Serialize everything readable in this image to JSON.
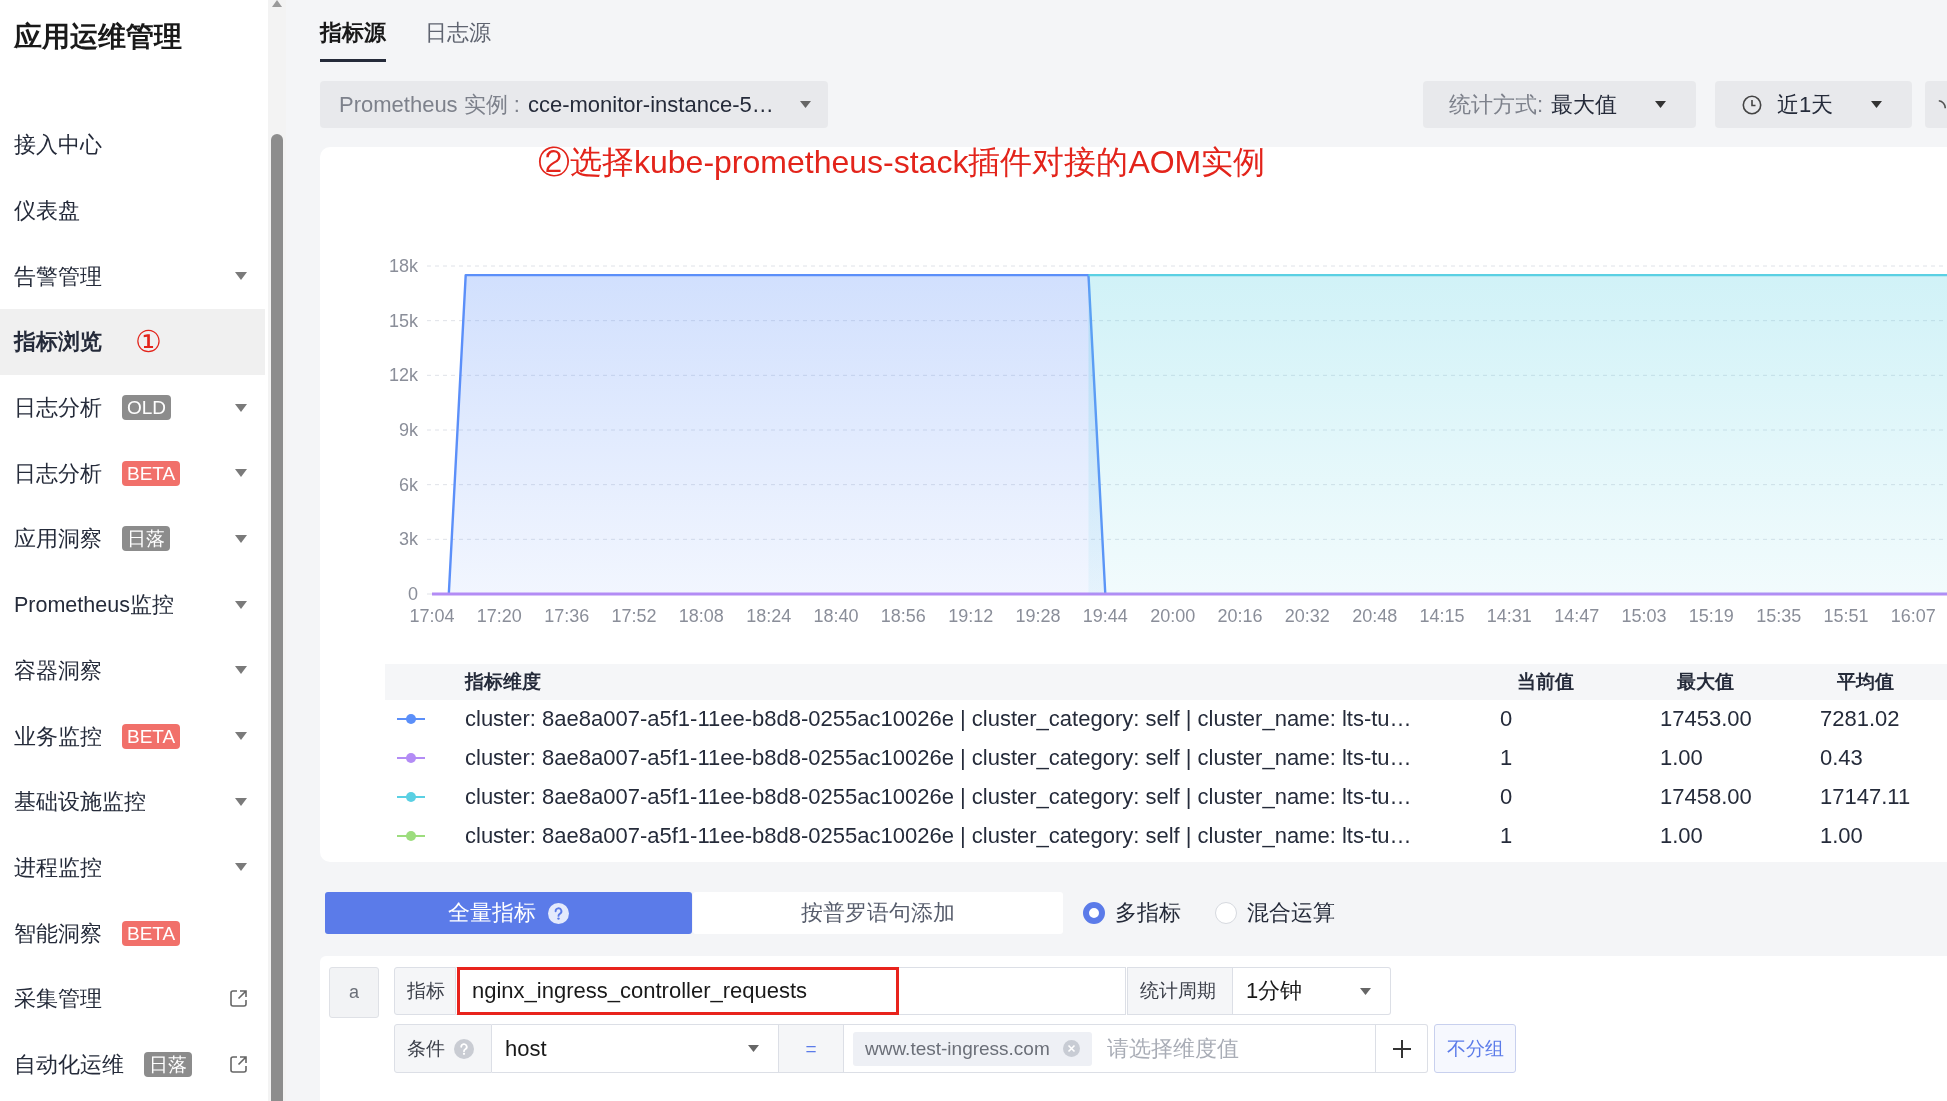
{
  "sidebar": {
    "title": "应用运维管理",
    "items": [
      {
        "label": "接入中心",
        "selected": false,
        "kind": "page"
      },
      {
        "label": "仪表盘",
        "selected": false,
        "kind": "page"
      },
      {
        "label": "告警管理",
        "selected": false,
        "kind": "menu"
      },
      {
        "label": "指标浏览",
        "selected": true,
        "kind": "page",
        "annotation": "①"
      },
      {
        "label": "日志分析",
        "selected": false,
        "kind": "menu",
        "badge": {
          "text": "OLD",
          "color": "#8c8c8c"
        }
      },
      {
        "label": "日志分析",
        "selected": false,
        "kind": "menu",
        "badge": {
          "text": "BETA",
          "color": "#f1706a"
        }
      },
      {
        "label": "应用洞察",
        "selected": false,
        "kind": "menu",
        "badge": {
          "text": "日落",
          "color": "#8c8c8c"
        }
      },
      {
        "label": "Prometheus监控",
        "selected": false,
        "kind": "menu"
      },
      {
        "label": "容器洞察",
        "selected": false,
        "kind": "menu"
      },
      {
        "label": "业务监控",
        "selected": false,
        "kind": "menu",
        "badge": {
          "text": "BETA",
          "color": "#f1706a"
        }
      },
      {
        "label": "基础设施监控",
        "selected": false,
        "kind": "menu"
      },
      {
        "label": "进程监控",
        "selected": false,
        "kind": "menu"
      },
      {
        "label": "智能洞察",
        "selected": false,
        "kind": "page",
        "badge": {
          "text": "BETA",
          "color": "#f1706a"
        }
      },
      {
        "label": "采集管理",
        "selected": false,
        "kind": "external"
      },
      {
        "label": "自动化运维",
        "selected": false,
        "kind": "external",
        "badge": {
          "text": "日落",
          "color": "#8c8c8c"
        }
      }
    ]
  },
  "source_tabs": [
    {
      "label": "指标源",
      "selected": true
    },
    {
      "label": "日志源",
      "selected": false
    }
  ],
  "toolbar": {
    "instance_select": {
      "label": "Prometheus 实例 :",
      "value": "cce-monitor-instance-5…"
    },
    "stat_select": {
      "label": "统计方式:",
      "value": "最大值"
    },
    "time_select": {
      "value": "近1天"
    }
  },
  "chart_card": {
    "annotation": "②选择kube-prometheus-stack插件对接的AOM实例",
    "chart_data": {
      "type": "area",
      "grid": true,
      "categories": [
        "17:04",
        null,
        null,
        null,
        "17:20",
        null,
        null,
        null,
        "17:36",
        null,
        null,
        null,
        "17:52",
        null,
        null,
        null,
        "18:08",
        null,
        null,
        null,
        "18:24",
        null,
        null,
        null,
        "18:40",
        null,
        null,
        null,
        "18:56",
        null,
        null,
        null,
        "19:12",
        null,
        null,
        null,
        "19:28",
        null,
        null,
        null,
        "19:44",
        null,
        null,
        null,
        "20:00",
        null,
        null,
        null,
        "20:16",
        null,
        null,
        null,
        "20:32",
        null,
        null,
        null,
        "20:48",
        null,
        null,
        null,
        "14:15",
        null,
        null,
        null,
        "14:31",
        null,
        null,
        null,
        "14:47",
        null,
        null,
        null,
        "15:03",
        null,
        null,
        null,
        "15:19",
        null,
        null,
        null,
        "15:35",
        null,
        null,
        null,
        "15:51",
        null,
        null,
        null,
        "16:07",
        null,
        null
      ],
      "ylim": [
        0,
        18000
      ],
      "yticks": [
        {
          "value": 0,
          "label": "0"
        },
        {
          "value": 3000,
          "label": "3k"
        },
        {
          "value": 6000,
          "label": "6k"
        },
        {
          "value": 9000,
          "label": "9k"
        },
        {
          "value": 12000,
          "label": "12k"
        },
        {
          "value": 15000,
          "label": "15k"
        },
        {
          "value": 18000,
          "label": "18k"
        }
      ],
      "series": [
        {
          "color": "#5b8ff9",
          "values": [
            null,
            0,
            17500,
            17500,
            17500,
            17500,
            17500,
            17500,
            17500,
            17500,
            17500,
            17500,
            17500,
            17500,
            17500,
            17500,
            17500,
            17500,
            17500,
            17500,
            17500,
            17500,
            17500,
            17500,
            17500,
            17500,
            17500,
            17500,
            17500,
            17500,
            17500,
            17500,
            17500,
            17500,
            17500,
            17500,
            17500,
            17500,
            17500,
            17500,
            0,
            null,
            null,
            null,
            null,
            null,
            null,
            null,
            null,
            null,
            null,
            null,
            null,
            null,
            null,
            null,
            null,
            null,
            null,
            null,
            null,
            null,
            null,
            null,
            null,
            null,
            null,
            null,
            null,
            null,
            null,
            null,
            null,
            null,
            null,
            null,
            null,
            null,
            null,
            null,
            null,
            null,
            null,
            null,
            null,
            null,
            null,
            null,
            null,
            null,
            null
          ]
        },
        {
          "color": "#b38cf5",
          "type": "line",
          "values": [
            0,
            0,
            0,
            0,
            0,
            0,
            0,
            0,
            0,
            0,
            0,
            0,
            0,
            0,
            0,
            0,
            0,
            0,
            0,
            0,
            0,
            0,
            0,
            0,
            0,
            0,
            0,
            0,
            0,
            0,
            0,
            0,
            0,
            0,
            0,
            0,
            0,
            0,
            0,
            0,
            0,
            0,
            0,
            0,
            0,
            0,
            0,
            0,
            0,
            0,
            0,
            0,
            0,
            0,
            0,
            0,
            0,
            0,
            0,
            0,
            0,
            0,
            0,
            0,
            0,
            0,
            0,
            0,
            0,
            0,
            0,
            0,
            0,
            0,
            0,
            0,
            0,
            0,
            0,
            0,
            0,
            0,
            0,
            0,
            0,
            0,
            0,
            0,
            0,
            0,
            0
          ]
        },
        {
          "color": "#5ad0e3",
          "values": [
            null,
            null,
            null,
            null,
            null,
            null,
            null,
            null,
            null,
            null,
            null,
            null,
            null,
            null,
            null,
            null,
            null,
            null,
            null,
            null,
            null,
            null,
            null,
            null,
            null,
            null,
            null,
            null,
            null,
            null,
            null,
            null,
            null,
            null,
            null,
            null,
            null,
            null,
            null,
            17500,
            17500,
            17500,
            17500,
            17500,
            17500,
            17500,
            17500,
            17500,
            17500,
            17500,
            17500,
            17500,
            17500,
            17500,
            17500,
            17500,
            17500,
            17500,
            17500,
            17500,
            17500,
            17500,
            17500,
            17500,
            17500,
            17500,
            17500,
            17500,
            17500,
            17500,
            17500,
            17500,
            17500,
            17500,
            17500,
            17500,
            17500,
            17500,
            17500,
            17500,
            17500,
            17500,
            17500,
            17500,
            17500,
            17500,
            17500,
            17500,
            17500,
            17500,
            17500
          ]
        }
      ]
    },
    "table": {
      "columns": [
        "指标维度",
        "当前值",
        "最大值",
        "平均值"
      ],
      "rows": [
        {
          "color": "#5b8ff9",
          "dimension": "cluster: 8ae8a007-a5f1-11ee-b8d8-0255ac10026e | cluster_category: self | cluster_name: lts-tu…",
          "current": "0",
          "max": "17453.00",
          "avg": "7281.02"
        },
        {
          "color": "#b38cf5",
          "dimension": "cluster: 8ae8a007-a5f1-11ee-b8d8-0255ac10026e | cluster_category: self | cluster_name: lts-tu…",
          "current": "1",
          "max": "1.00",
          "avg": "0.43"
        },
        {
          "color": "#5ad0e3",
          "dimension": "cluster: 8ae8a007-a5f1-11ee-b8d8-0255ac10026e | cluster_category: self | cluster_name: lts-tu…",
          "current": "0",
          "max": "17458.00",
          "avg": "17147.11"
        },
        {
          "color": "#9ddd7e",
          "dimension": "cluster: 8ae8a007-a5f1-11ee-b8d8-0255ac10026e | cluster_category: self | cluster_name: lts-tu…",
          "current": "1",
          "max": "1.00",
          "avg": "1.00"
        }
      ]
    }
  },
  "query_mode": {
    "tabs": [
      {
        "label": "全量指标",
        "selected": true,
        "help": true
      },
      {
        "label": "按普罗语句添加",
        "selected": false,
        "help": false
      }
    ],
    "radios": [
      {
        "label": "多指标",
        "selected": true
      },
      {
        "label": "混合运算",
        "selected": false
      }
    ]
  },
  "query": {
    "alias": "a",
    "metric_label": "指标",
    "metric": "nginx_ingress_controller_requests",
    "highlighted": true,
    "period_label": "统计周期",
    "period": "1分钟",
    "condition_label": "条件",
    "condition_help": true,
    "condition_key": "host",
    "operator": "=",
    "tags": [
      "www.test-ingress.com"
    ],
    "value_placeholder": "请选择维度值",
    "group_button": "不分组"
  }
}
